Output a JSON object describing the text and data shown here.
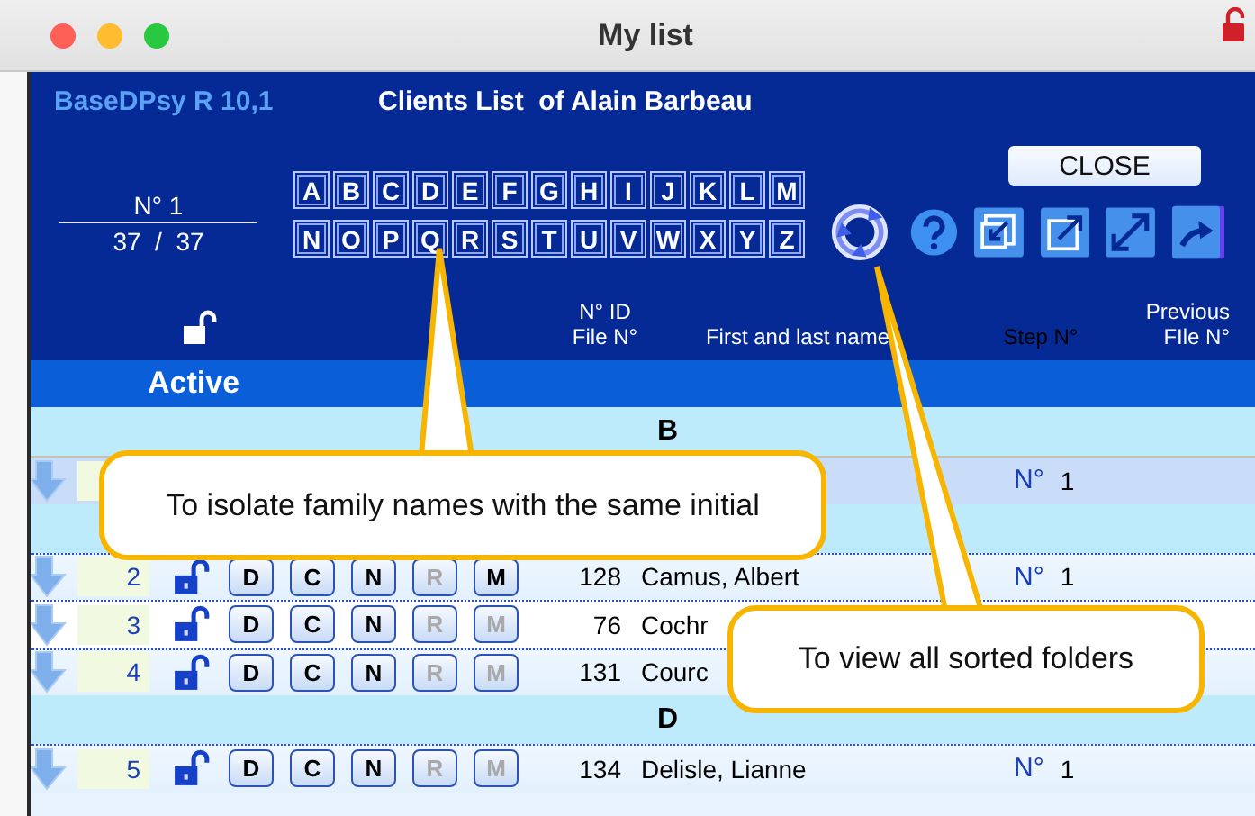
{
  "window": {
    "title": "My list"
  },
  "app": {
    "brand": "BaseDPsy R 10,1",
    "title": "Clients List  of Alain Barbeau"
  },
  "counter": {
    "current": "N° 1",
    "position": "37  /  37"
  },
  "letter_rows": [
    [
      "A",
      "B",
      "C",
      "D",
      "E",
      "F",
      "G",
      "H",
      "I",
      "J",
      "K",
      "L",
      "M"
    ],
    [
      "N",
      "O",
      "P",
      "Q",
      "R",
      "S",
      "T",
      "U",
      "V",
      "W",
      "X",
      "Y",
      "Z"
    ]
  ],
  "close_button": "CLOSE",
  "columns": [
    {
      "lines": [
        "N° ID",
        "File N°"
      ],
      "disabled": false
    },
    {
      "lines": [
        "First and last name"
      ],
      "disabled": false
    },
    {
      "lines": [
        "Step N°"
      ],
      "disabled": true
    },
    {
      "lines": [
        "Previous",
        "FIle N°"
      ],
      "disabled": false
    }
  ],
  "group": "Active",
  "rows": [
    {
      "kind": "section",
      "letter": "B"
    },
    {
      "kind": "client",
      "selected": true,
      "step_label": "N°",
      "step": "1"
    },
    {
      "kind": "section"
    },
    {
      "kind": "client",
      "selected": false,
      "number": "2",
      "id": "128",
      "name": "Camus, Albert",
      "step_label": "N°",
      "step": "1",
      "buttons": [
        {
          "label": "D",
          "disabled": false
        },
        {
          "label": "C",
          "disabled": false
        },
        {
          "label": "N",
          "disabled": false
        },
        {
          "label": "R",
          "disabled": true
        },
        {
          "label": "M",
          "disabled": false
        }
      ]
    },
    {
      "kind": "client",
      "selected": false,
      "number": "3",
      "id": "76",
      "name": "Cochr",
      "buttons": [
        {
          "label": "D",
          "disabled": false
        },
        {
          "label": "C",
          "disabled": false
        },
        {
          "label": "N",
          "disabled": false
        },
        {
          "label": "R",
          "disabled": true
        },
        {
          "label": "M",
          "disabled": true
        }
      ]
    },
    {
      "kind": "client",
      "selected": false,
      "number": "4",
      "id": "131",
      "name": "Courc",
      "buttons": [
        {
          "label": "D",
          "disabled": false
        },
        {
          "label": "C",
          "disabled": false
        },
        {
          "label": "N",
          "disabled": false
        },
        {
          "label": "R",
          "disabled": true
        },
        {
          "label": "M",
          "disabled": true
        }
      ]
    },
    {
      "kind": "section",
      "letter": "D"
    },
    {
      "kind": "client",
      "selected": false,
      "number": "5",
      "id": "134",
      "name": "Delisle, Lianne",
      "step_label": "N°",
      "step": "1",
      "buttons": [
        {
          "label": "D",
          "disabled": false
        },
        {
          "label": "C",
          "disabled": false
        },
        {
          "label": "N",
          "disabled": false
        },
        {
          "label": "R",
          "disabled": true
        },
        {
          "label": "M",
          "disabled": true
        }
      ]
    }
  ],
  "callouts": [
    {
      "text": "To isolate family names with the same initial"
    },
    {
      "text": "To view all sorted folders"
    }
  ]
}
